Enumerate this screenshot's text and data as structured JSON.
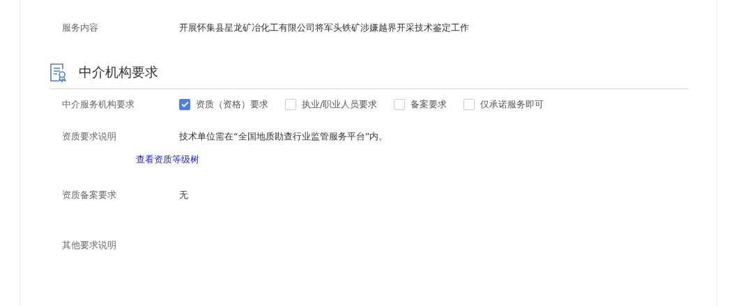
{
  "service": {
    "label": "服务内容",
    "value": "开展怀集县星龙矿冶化工有限公司将军头铁矿涉嫌越界开采技术鉴定工作"
  },
  "section": {
    "title": "中介机构要求"
  },
  "requirement": {
    "label": "中介服务机构要求",
    "options": [
      {
        "label": "资质（资格）要求",
        "checked": true
      },
      {
        "label": "执业/职业人员要求",
        "checked": false
      },
      {
        "label": "备案要求",
        "checked": false
      },
      {
        "label": "仅承诺服务即可",
        "checked": false
      }
    ]
  },
  "qualification": {
    "label": "资质要求说明",
    "value": "技术单位需在“全国地质勘查行业监管服务平台”内。",
    "link": "查看资质等级树"
  },
  "filing": {
    "label": "资质备案要求",
    "value": "无"
  },
  "other": {
    "label": "其他要求说明"
  }
}
